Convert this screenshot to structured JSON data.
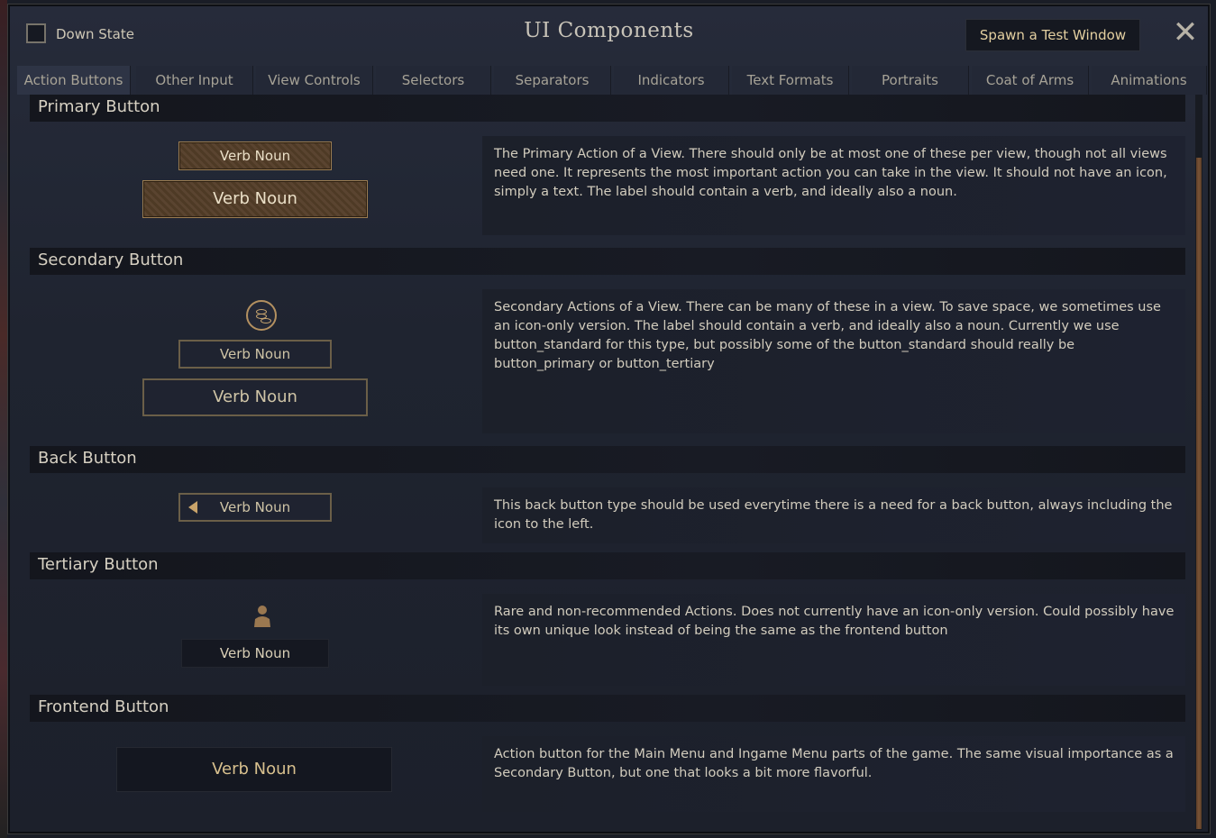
{
  "header": {
    "checkbox_label": "Down State",
    "title": "UI Components",
    "spawn_button": "Spawn a Test Window",
    "close_icon": "✕"
  },
  "tabs": [
    {
      "label": "Action Buttons",
      "active": true
    },
    {
      "label": "Other Input"
    },
    {
      "label": "View Controls"
    },
    {
      "label": "Selectors"
    },
    {
      "label": "Separators"
    },
    {
      "label": "Indicators"
    },
    {
      "label": "Text Formats"
    },
    {
      "label": "Portraits"
    },
    {
      "label": "Coat of Arms"
    },
    {
      "label": "Animations"
    }
  ],
  "sections": {
    "primary": {
      "title": "Primary Button",
      "small_button": "Verb Noun",
      "large_button": "Verb Noun",
      "description": "The Primary Action of a View. There should only be at most one of these per view, though not all views need one. It represents the most important action you can take in the view. It should not have an icon, simply a text. The label should contain a verb, and ideally also a noun."
    },
    "secondary": {
      "title": "Secondary Button",
      "icon": "coins-icon",
      "small_button": "Verb Noun",
      "large_button": "Verb Noun",
      "description": "Secondary Actions of a View. There can be many of these in a view. To save space, we sometimes use an icon-only version. The label should contain a verb, and ideally also a noun. Currently we use button_standard for this type, but possibly some of the button_standard should really be button_primary or button_tertiary"
    },
    "back": {
      "title": "Back Button",
      "button": "Verb Noun",
      "icon": "back-arrow-icon",
      "description": "This back button type should be used everytime there is a need for a back button, always including the icon to the left."
    },
    "tertiary": {
      "title": "Tertiary Button",
      "icon": "person-icon",
      "button": "Verb Noun",
      "description": "Rare and non-recommended Actions. Does not currently have an icon-only version. Could possibly have its own unique look instead of being the same as the frontend button"
    },
    "frontend": {
      "title": "Frontend Button",
      "button": "Verb Noun",
      "description": "Action button for the Main Menu and Ingame Menu parts of the game. The same visual importance as a Secondary Button, but one that looks a bit more flavorful."
    }
  },
  "colors": {
    "accent_gold": "#e3cfa0",
    "primary_border": "#9b7d52",
    "background": "#1f2430"
  }
}
